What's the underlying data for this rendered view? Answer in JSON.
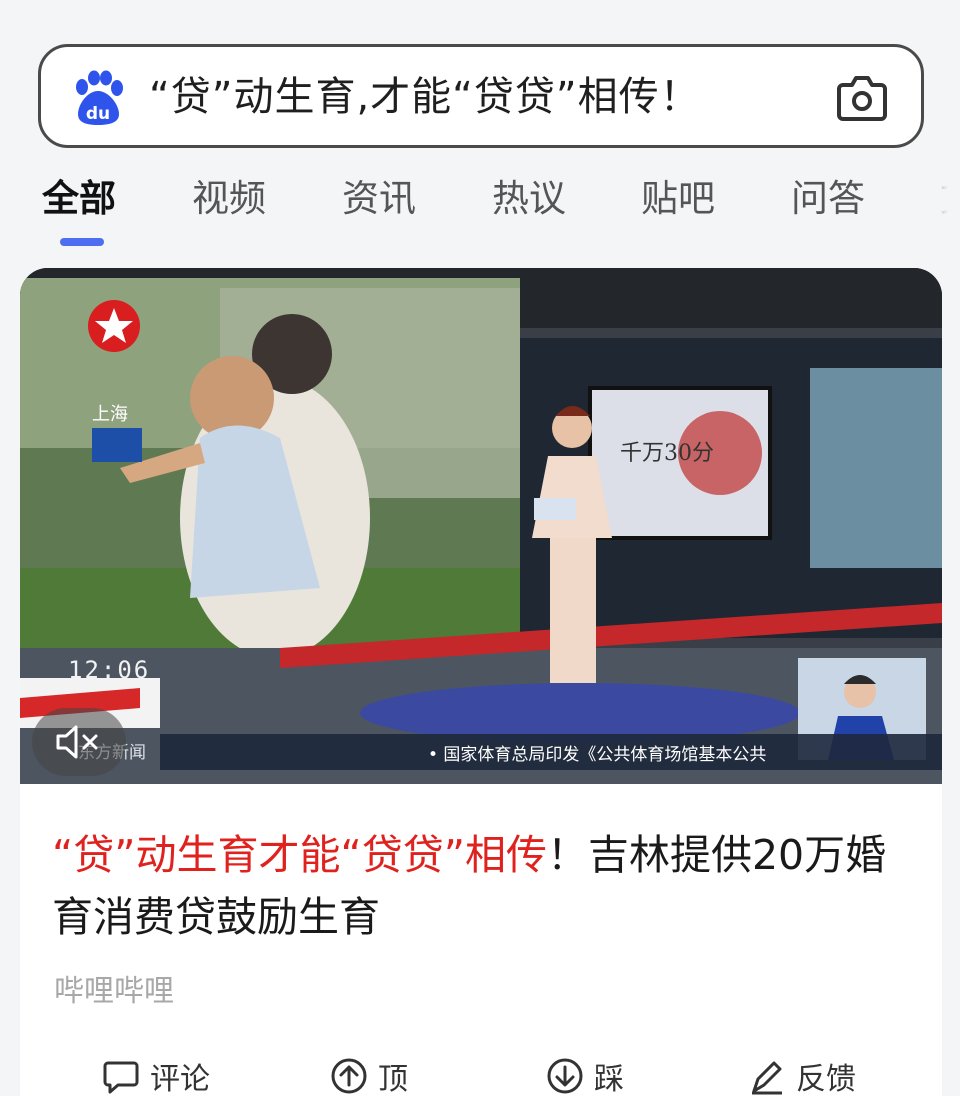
{
  "search": {
    "query": "“贷”动生育,才能“贷贷”相传！",
    "left_icon": "baidu-paw-logo",
    "right_icon": "camera-icon"
  },
  "tabs": [
    {
      "label": "全部",
      "active": true
    },
    {
      "label": "视频",
      "active": false
    },
    {
      "label": "资讯",
      "active": false
    },
    {
      "label": "热议",
      "active": false
    },
    {
      "label": "贴吧",
      "active": false
    },
    {
      "label": "问答",
      "active": false
    },
    {
      "label": "文",
      "active": false
    }
  ],
  "result": {
    "video": {
      "clock": "12:06",
      "city": "上海",
      "channel": "东方新闻",
      "ticker": "• 国家体育总局印发《公共体育场馆基本公共",
      "screen_caption": "千万30分",
      "mute_icon": "mute-icon"
    },
    "title_highlight": "“贷”动生育才能“贷贷”相传",
    "title_rest": "！吉林提供20万婚育消费贷鼓励生育",
    "source": "哔哩哔哩",
    "actions": {
      "comment": "评论",
      "upvote": "顶",
      "downvote": "踩",
      "feedback": "反馈"
    }
  },
  "colors": {
    "accent": "#4e6ef2",
    "title_highlight": "#e0221e",
    "source_text": "#a8a8a8"
  }
}
